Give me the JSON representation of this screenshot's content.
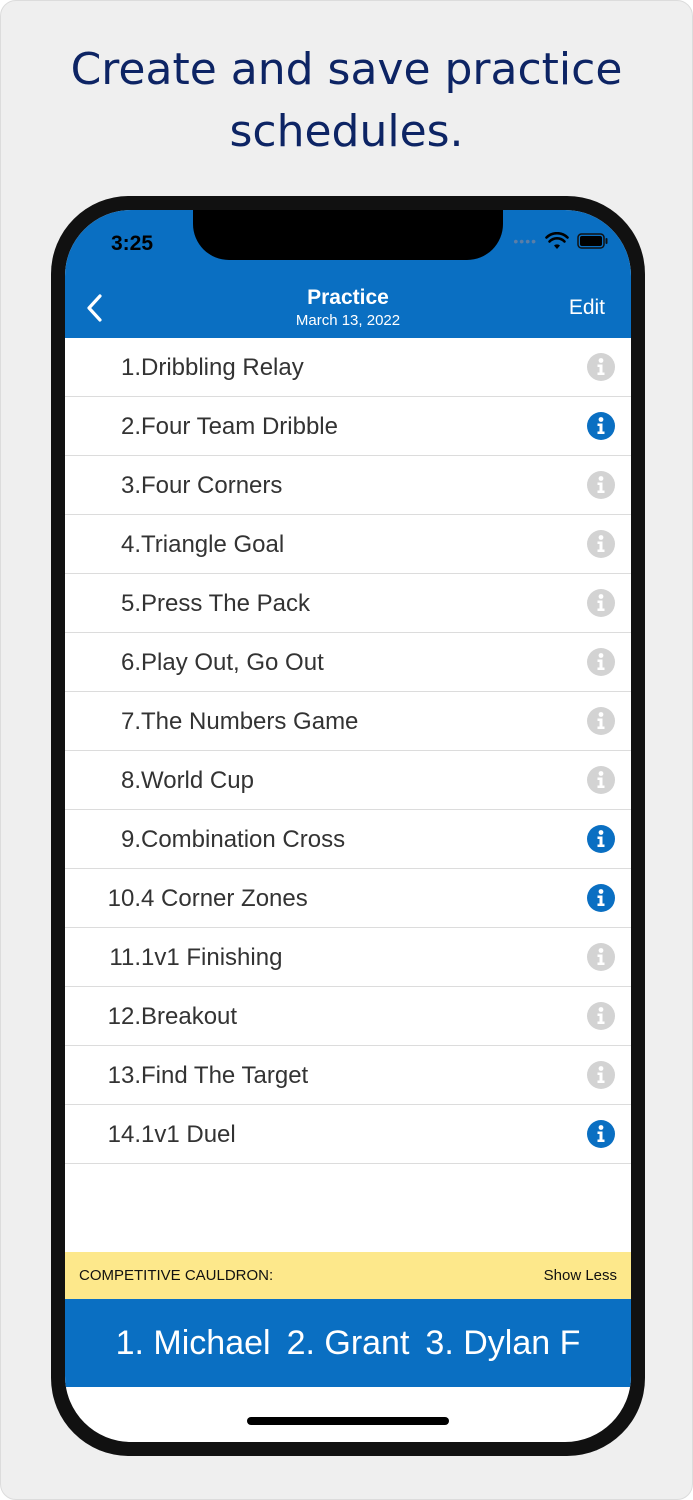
{
  "headline": "Create and save practice schedules.",
  "status_bar": {
    "time": "3:25"
  },
  "nav": {
    "title": "Practice",
    "subtitle": "March 13, 2022",
    "edit_label": "Edit"
  },
  "drills": [
    {
      "number": "1.",
      "name": "Dribbling Relay",
      "info_active": false
    },
    {
      "number": "2.",
      "name": "Four Team Dribble",
      "info_active": true
    },
    {
      "number": "3.",
      "name": "Four Corners",
      "info_active": false
    },
    {
      "number": "4.",
      "name": "Triangle Goal",
      "info_active": false
    },
    {
      "number": "5.",
      "name": "Press The Pack",
      "info_active": false
    },
    {
      "number": "6.",
      "name": "Play Out, Go Out",
      "info_active": false
    },
    {
      "number": "7.",
      "name": "The Numbers Game",
      "info_active": false
    },
    {
      "number": "8.",
      "name": "World Cup",
      "info_active": false
    },
    {
      "number": "9.",
      "name": "Combination Cross",
      "info_active": true
    },
    {
      "number": "10.",
      "name": "4 Corner Zones",
      "info_active": true
    },
    {
      "number": "11.",
      "name": "1v1 Finishing",
      "info_active": false
    },
    {
      "number": "12.",
      "name": "Breakout",
      "info_active": false
    },
    {
      "number": "13.",
      "name": "Find The Target",
      "info_active": false
    },
    {
      "number": "14.",
      "name": "1v1 Duel",
      "info_active": true
    }
  ],
  "cauldron": {
    "label": "COMPETITIVE CAULDRON:",
    "toggle_label": "Show Less",
    "leaders": [
      "1. Michael",
      "2. Grant",
      "3. Dylan F"
    ]
  },
  "colors": {
    "brand_blue": "#0a6fc2",
    "headline_navy": "#0d2464",
    "info_active": "#0a6fc2",
    "info_inactive": "#d3d3d3",
    "cauldron_yellow": "#fde88b"
  },
  "icons": {
    "back": "chevron-left-icon",
    "info": "info-circle-icon",
    "signal": "signal-dots-icon",
    "wifi": "wifi-icon",
    "battery": "battery-icon"
  }
}
